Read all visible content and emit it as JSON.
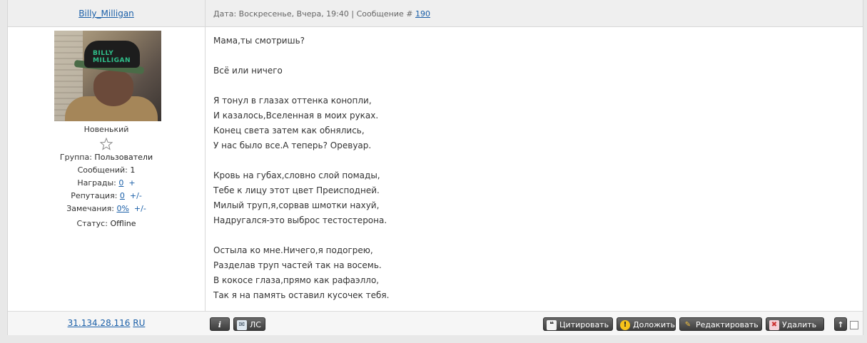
{
  "header": {
    "author": "Billy_Milligan",
    "meta_prefix": "Дата: Воскресенье, Вчера, 19:40 | Сообщение #",
    "post_number": "190"
  },
  "user": {
    "avatar_caption": "BILLY MILLIGAN",
    "rank": "Новенький",
    "group_label": "Группа:",
    "group_value": "Пользователи",
    "messages_label": "Сообщений:",
    "messages_value": "1",
    "awards_label": "Награды:",
    "awards_value": "0",
    "awards_action": "+",
    "reputation_label": "Репутация:",
    "reputation_value": "0",
    "reputation_action": "+/-",
    "warnings_label": "Замечания:",
    "warnings_value": "0%",
    "warnings_action": "+/-",
    "status_label": "Статус:",
    "status_value": "Offline"
  },
  "post": {
    "lines": [
      "Мама,ты смотришь?",
      "",
      "Всё или ничего",
      "",
      "Я тонул в глазах оттенка конопли,",
      "И казалось,Вселенная в моих руках.",
      "Конец света затем как обнялись,",
      "У нас было все.А теперь? Оревуар.",
      "",
      "Кровь на губах,словно слой помады,",
      "Тебе к лицу этот цвет Преисподней.",
      "Милый труп,я,сорвав шмотки нахуй,",
      "Надругался-это выброс тестостерона.",
      "",
      "Остыла ко мне.Ничего,я подогрею,",
      "Разделав труп частей так на восемь.",
      "В кокосе глаза,прямо как рафаэлло,",
      "Так я на память оставил кусочек тебя."
    ]
  },
  "footer": {
    "ip": "31.134.28.116",
    "country": "RU",
    "info_label": "i",
    "pm_label": "ЛС",
    "quote_label": "Цитировать",
    "report_label": "Доложить",
    "edit_label": "Редактировать",
    "delete_label": "Удалить",
    "up_label": "↑"
  },
  "colors": {
    "link": "#1a5fa8",
    "button_dark": "#3c3c3c",
    "header_bg": "#efefef"
  }
}
